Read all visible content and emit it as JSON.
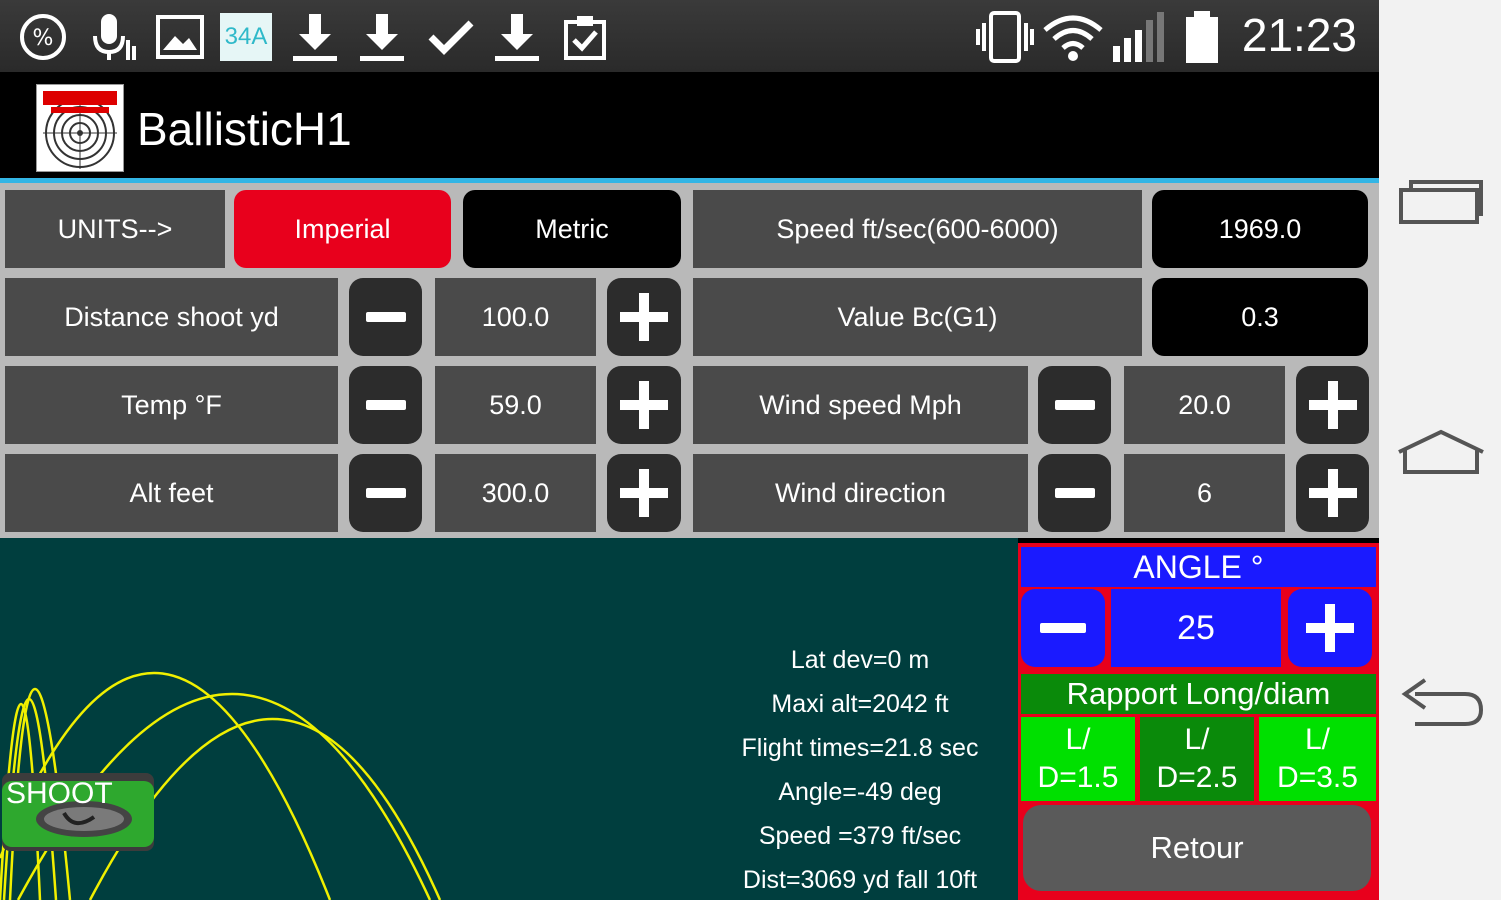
{
  "status_bar": {
    "icons": [
      "percent-icon",
      "mic-icon",
      "image-icon",
      "34a-icon",
      "download-icon",
      "download-icon",
      "check-icon",
      "download-icon",
      "clipboard-check-icon",
      "vibrate-icon",
      "wifi-icon",
      "signal-icon",
      "battery-icon"
    ],
    "badge_34a": "34A",
    "percent_glyph": "%",
    "time": "21:23"
  },
  "app": {
    "title": "BallisticH1"
  },
  "units": {
    "label": "UNITS-->",
    "imperial": "Imperial",
    "metric": "Metric",
    "selected": "Imperial"
  },
  "speed": {
    "label": "Speed ft/sec(600-6000)",
    "value": "1969.0"
  },
  "bc": {
    "label": "Value Bc(G1)",
    "value": "0.3"
  },
  "distance": {
    "label": "Distance shoot yd",
    "value": "100.0"
  },
  "temp": {
    "label": "Temp °F",
    "value": "59.0"
  },
  "alt": {
    "label": "Alt feet",
    "value": "300.0"
  },
  "wind_speed": {
    "label": "Wind speed Mph",
    "value": "20.0"
  },
  "wind_direction": {
    "label": "Wind direction",
    "value": "6"
  },
  "results": {
    "lat_dev": "Lat dev=0 m",
    "maxi_alt": "Maxi alt=2042 ft",
    "flight_times": "Flight times=21.8 sec",
    "angle": "Angle=-49 deg",
    "speed": "Speed =379 ft/sec",
    "dist": "Dist=3069 yd fall 10ft"
  },
  "shoot": {
    "label": "SHOOT"
  },
  "angle_panel": {
    "title": "ANGLE °",
    "value": "25"
  },
  "rapport": {
    "title": "Rapport Long/diam",
    "options": [
      {
        "line1": "L/",
        "line2": "D=1.5"
      },
      {
        "line1": "L/",
        "line2": "D=2.5"
      },
      {
        "line1": "L/",
        "line2": "D=3.5"
      }
    ],
    "selected": "D=2.5"
  },
  "retour": {
    "label": "Retour"
  },
  "colors": {
    "accent_red": "#e8001c",
    "accent_blue": "#1a1aff",
    "accent_green": "#00e000",
    "dark_green": "#0a8a0a",
    "graph_bg": "#003e3e",
    "trajectory": "#f0f000",
    "holo_blue": "#33b5e5"
  },
  "nav_bar": {
    "icons": [
      "recent-apps-icon",
      "home-icon",
      "back-icon"
    ]
  }
}
